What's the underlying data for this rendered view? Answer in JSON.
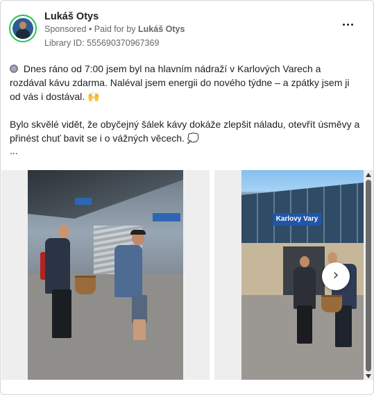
{
  "post": {
    "author": "Lukáš Otys",
    "sponsored": "Sponsored",
    "paid_prefix": " • Paid for by ",
    "paid_by": "Lukáš Otys",
    "library_id": "Library ID: 555690370967369",
    "paragraph1": "Dnes ráno od 7:00 jsem byl na hlavním nádraží v Karlových Varech a rozdával kávu zdarma. Naléval jsem energii do nového týdne – a zpátky jsem ji od vás i dostával.",
    "emoji_hands": "🙌",
    "paragraph2": "Bylo skvělé vidět, že obyčejný šálek kávy dokáže zlepšit náladu, otevřít úsměvy a přinést chuť bavit se i o vážných věcech.",
    "emoji_bubble": "💭",
    "ellipsis": "..."
  },
  "carousel": {
    "sign_text": "Karlovy Vary",
    "next_arrow": "›"
  },
  "icons": {
    "more": "more-dots-icon",
    "coffee": "coffee-icon",
    "next": "chevron-right-icon"
  },
  "colors": {
    "avatar_ring": "#23c552",
    "text": "#1c1e21",
    "secondary": "#65676b",
    "station_sign": "#1f56a8"
  }
}
